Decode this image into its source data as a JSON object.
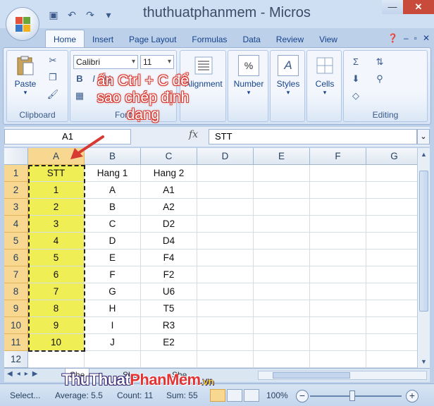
{
  "window": {
    "title": "thuthuatphanmem - Micros",
    "minimize": "—",
    "close": "✕"
  },
  "ribbon_tabs": [
    "Home",
    "Insert",
    "Page Layout",
    "Formulas",
    "Data",
    "Review",
    "View"
  ],
  "clipboard": {
    "paste_label": "Paste",
    "group_label": "Clipboard"
  },
  "font": {
    "name": "Calibri",
    "size": "11",
    "group_label": "Font"
  },
  "alignment": {
    "label": "Alignment"
  },
  "number": {
    "label": "Number",
    "symbol": "%"
  },
  "styles": {
    "label": "Styles"
  },
  "cells": {
    "label": "Cells"
  },
  "editing": {
    "group_label": "Editing"
  },
  "annotation": {
    "line1": "ấn Ctrl + C để",
    "line2": "sao chép định",
    "line3": "dạng"
  },
  "formula_bar": {
    "name_box": "A1",
    "fx": "fx",
    "content": "STT"
  },
  "columns": [
    "A",
    "B",
    "C",
    "D",
    "E",
    "F",
    "G"
  ],
  "rows": [
    {
      "num": "1",
      "a": "STT",
      "b": "Hang 1",
      "c": "Hang 2"
    },
    {
      "num": "2",
      "a": "1",
      "b": "A",
      "c": "A1"
    },
    {
      "num": "3",
      "a": "2",
      "b": "B",
      "c": "A2"
    },
    {
      "num": "4",
      "a": "3",
      "b": "C",
      "c": "D2"
    },
    {
      "num": "5",
      "a": "4",
      "b": "D",
      "c": "D4"
    },
    {
      "num": "6",
      "a": "5",
      "b": "E",
      "c": "F4"
    },
    {
      "num": "7",
      "a": "6",
      "b": "F",
      "c": "F2"
    },
    {
      "num": "8",
      "a": "7",
      "b": "G",
      "c": "U6"
    },
    {
      "num": "9",
      "a": "8",
      "b": "H",
      "c": "T5"
    },
    {
      "num": "10",
      "a": "9",
      "b": "I",
      "c": "R3"
    },
    {
      "num": "11",
      "a": "10",
      "b": "J",
      "c": "E2"
    },
    {
      "num": "12",
      "a": "",
      "b": "",
      "c": ""
    }
  ],
  "sheet_tabs": [
    "She",
    "She",
    "She"
  ],
  "watermark": {
    "part1": "ThuThuat",
    "part2": "PhanMem",
    "part3": ".vn"
  },
  "status": {
    "mode": "Select...",
    "average": "Average: 5.5",
    "count": "Count: 11",
    "sum": "Sum: 55",
    "zoom": "100%"
  },
  "colors": {
    "selected_fill": "#f0ee55",
    "header_highlight": "#f8d790",
    "annotation": "#d73a32"
  }
}
